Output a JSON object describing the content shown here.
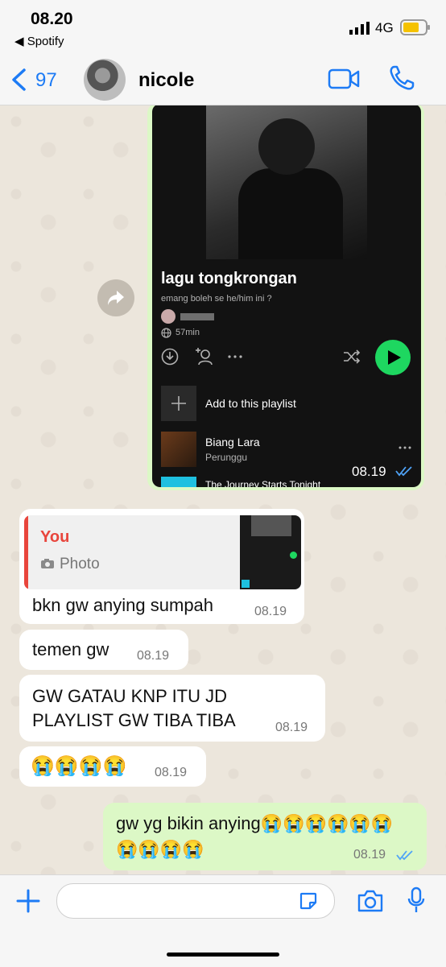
{
  "status_bar": {
    "time": "08.20",
    "back_app": "◀ Spotify",
    "network": "4G"
  },
  "header": {
    "back_count": "97",
    "contact_name": "nicole"
  },
  "spotify_share": {
    "playlist_title": "lagu tongkrongan",
    "playlist_description": "emang boleh se he/him ini ?",
    "duration": "57min",
    "add_label": "Add to this playlist",
    "song1_title": "Biang Lara",
    "song1_artist": "Perunggu",
    "song2_title": "The Journey Starts Tonight",
    "message_time": "08.19"
  },
  "reply_quote": {
    "author": "You",
    "type": "Photo"
  },
  "messages": [
    {
      "text": "bkn gw anying sumpah",
      "time": "08.19"
    },
    {
      "text": "temen gw",
      "time": "08.19"
    },
    {
      "text": "GW GATAU KNP ITU JD PLAYLIST GW TIBA TIBA",
      "time": "08.19"
    },
    {
      "text": "😭😭😭😭",
      "time": "08.19"
    }
  ],
  "outgoing": {
    "text": "gw yg bikin anying😭😭😭😭😭😭😭😭😭😭",
    "time": "08.19"
  },
  "colors": {
    "accent": "#1d7bf5",
    "spotify_green": "#1ed760",
    "reply_red": "#e8453c",
    "outgoing_bubble": "#dcf8c6"
  },
  "icons": [
    "chevron-left-icon",
    "video-call-icon",
    "phone-icon",
    "forward-icon",
    "download-icon",
    "add-user-icon",
    "more-icon",
    "shuffle-icon",
    "play-icon",
    "plus-icon",
    "camera-icon",
    "read-receipt-icon",
    "sticker-icon",
    "mic-icon"
  ]
}
